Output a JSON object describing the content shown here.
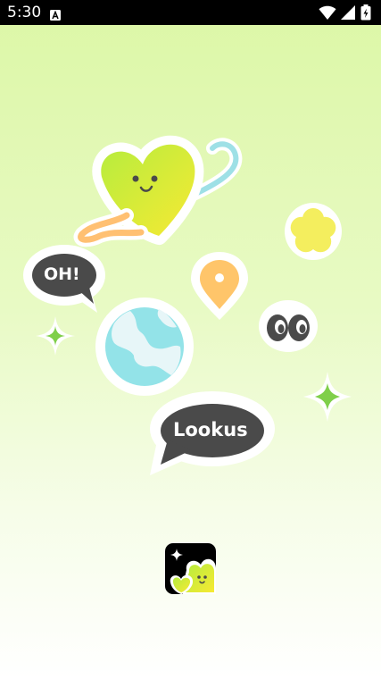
{
  "status_bar": {
    "time": "5:30",
    "notification_icon": "app-notification-icon",
    "icons": [
      "wifi-icon",
      "signal-icon",
      "battery-icon"
    ]
  },
  "splash": {
    "stickers": {
      "oh_bubble": {
        "text": "OH!"
      },
      "brand_bubble": {
        "text": "Lookus"
      }
    },
    "app_icon": "app-logo-icon"
  },
  "colors": {
    "background_top": "#dcf7a6",
    "background_bottom": "#ffffff",
    "heart_start": "#b6ec3e",
    "heart_end": "#f7ea33",
    "bubble": "#4a4a4a",
    "globe_sea": "#93e3e8",
    "pin": "#ffc56a",
    "flower": "#f4ee5e",
    "sparkle": "#7fcf4a",
    "status_bar": "#000000"
  }
}
